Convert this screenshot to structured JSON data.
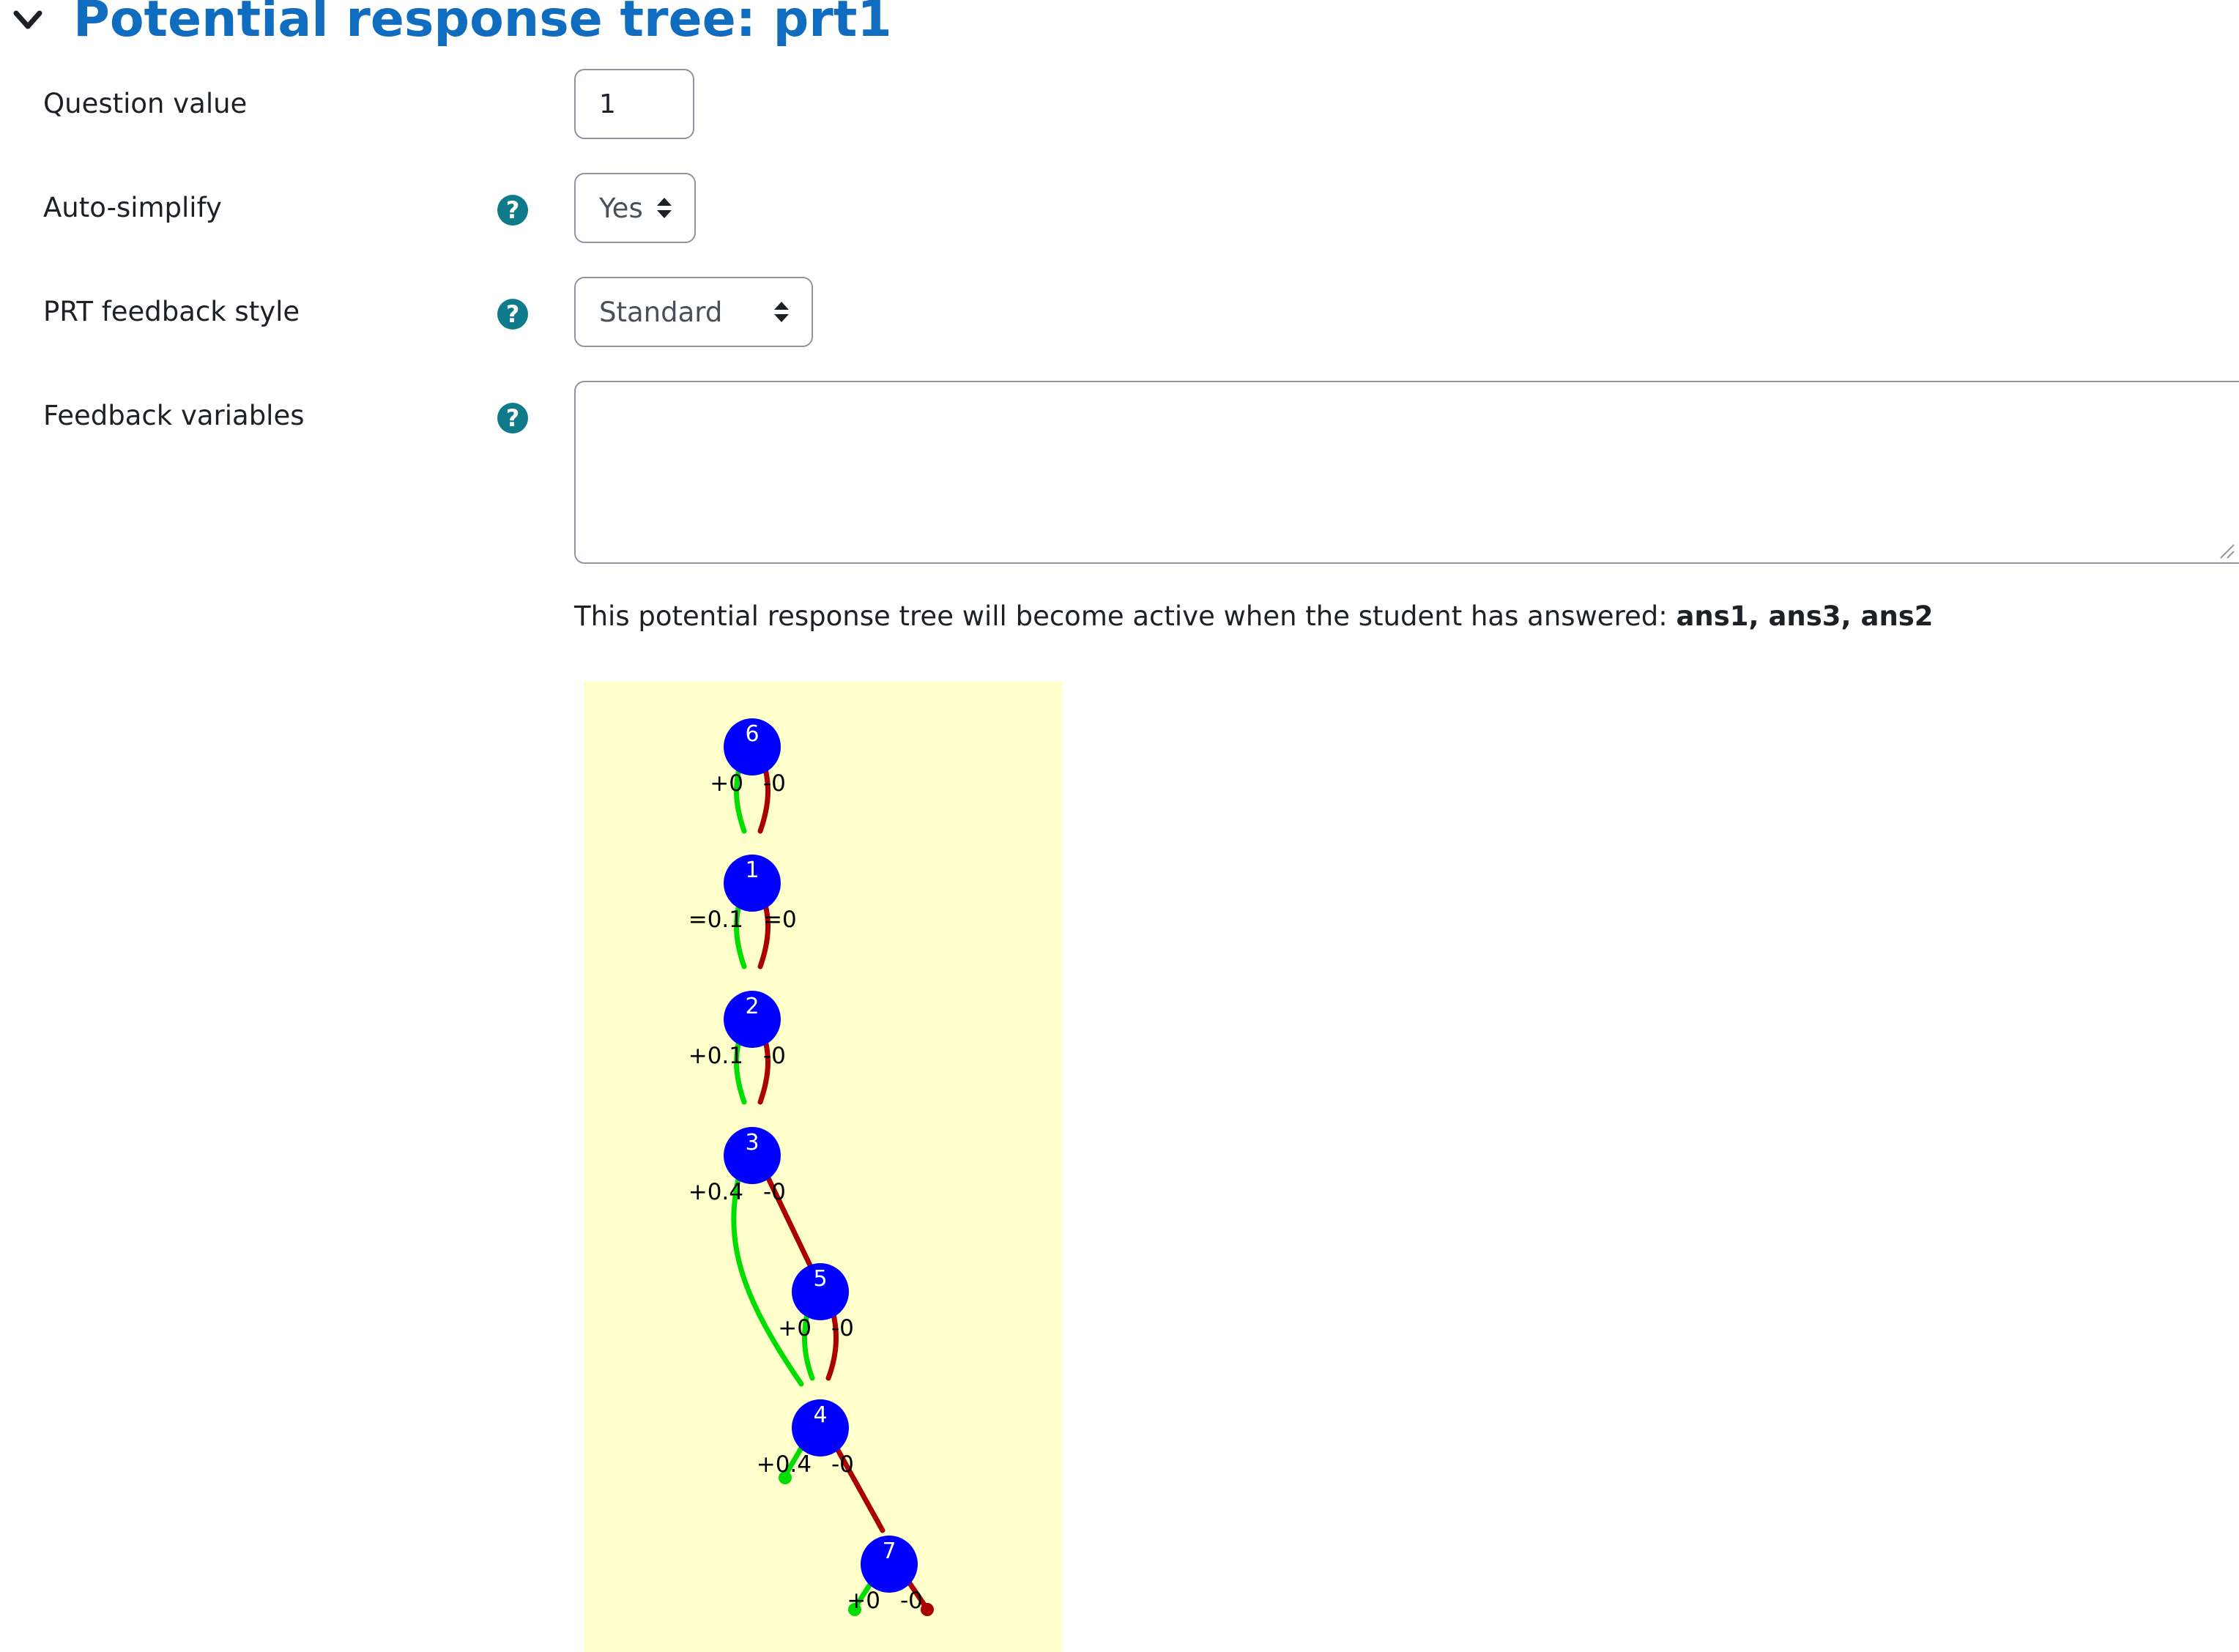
{
  "section": {
    "title": "Potential response tree: prt1"
  },
  "fields": {
    "question_value": {
      "label": "Question value",
      "value": "1"
    },
    "auto_simplify": {
      "label": "Auto-simplify",
      "value": "Yes"
    },
    "feedback_style": {
      "label": "PRT feedback style",
      "value": "Standard"
    },
    "feedback_variables": {
      "label": "Feedback variables",
      "value": ""
    }
  },
  "active_notice": {
    "text": "This potential response tree will become active when the student has answered: ",
    "answers": "ans1, ans3, ans2"
  },
  "icons": {
    "collapse": "chevron-down-icon",
    "help": "question-circle-icon",
    "select": "up-down-arrows-icon"
  },
  "colors": {
    "title": "#0f6cbf",
    "help_icon": "#0f7b8a",
    "graph_background": "#ffffcc",
    "node_fill": "#0000ff",
    "true_edge": "#00dd00",
    "false_edge": "#aa0000"
  },
  "tree": {
    "nodes": [
      {
        "id": "6",
        "true_label": "+0",
        "false_label": "-0"
      },
      {
        "id": "1",
        "true_label": "=0.1",
        "false_label": "=0"
      },
      {
        "id": "2",
        "true_label": "+0.1",
        "false_label": "-0"
      },
      {
        "id": "3",
        "true_label": "+0.4",
        "false_label": "-0"
      },
      {
        "id": "5",
        "true_label": "+0",
        "false_label": "-0"
      },
      {
        "id": "4",
        "true_label": "+0.4",
        "false_label": "-0"
      },
      {
        "id": "7",
        "true_label": "+0",
        "false_label": "-0"
      }
    ]
  }
}
